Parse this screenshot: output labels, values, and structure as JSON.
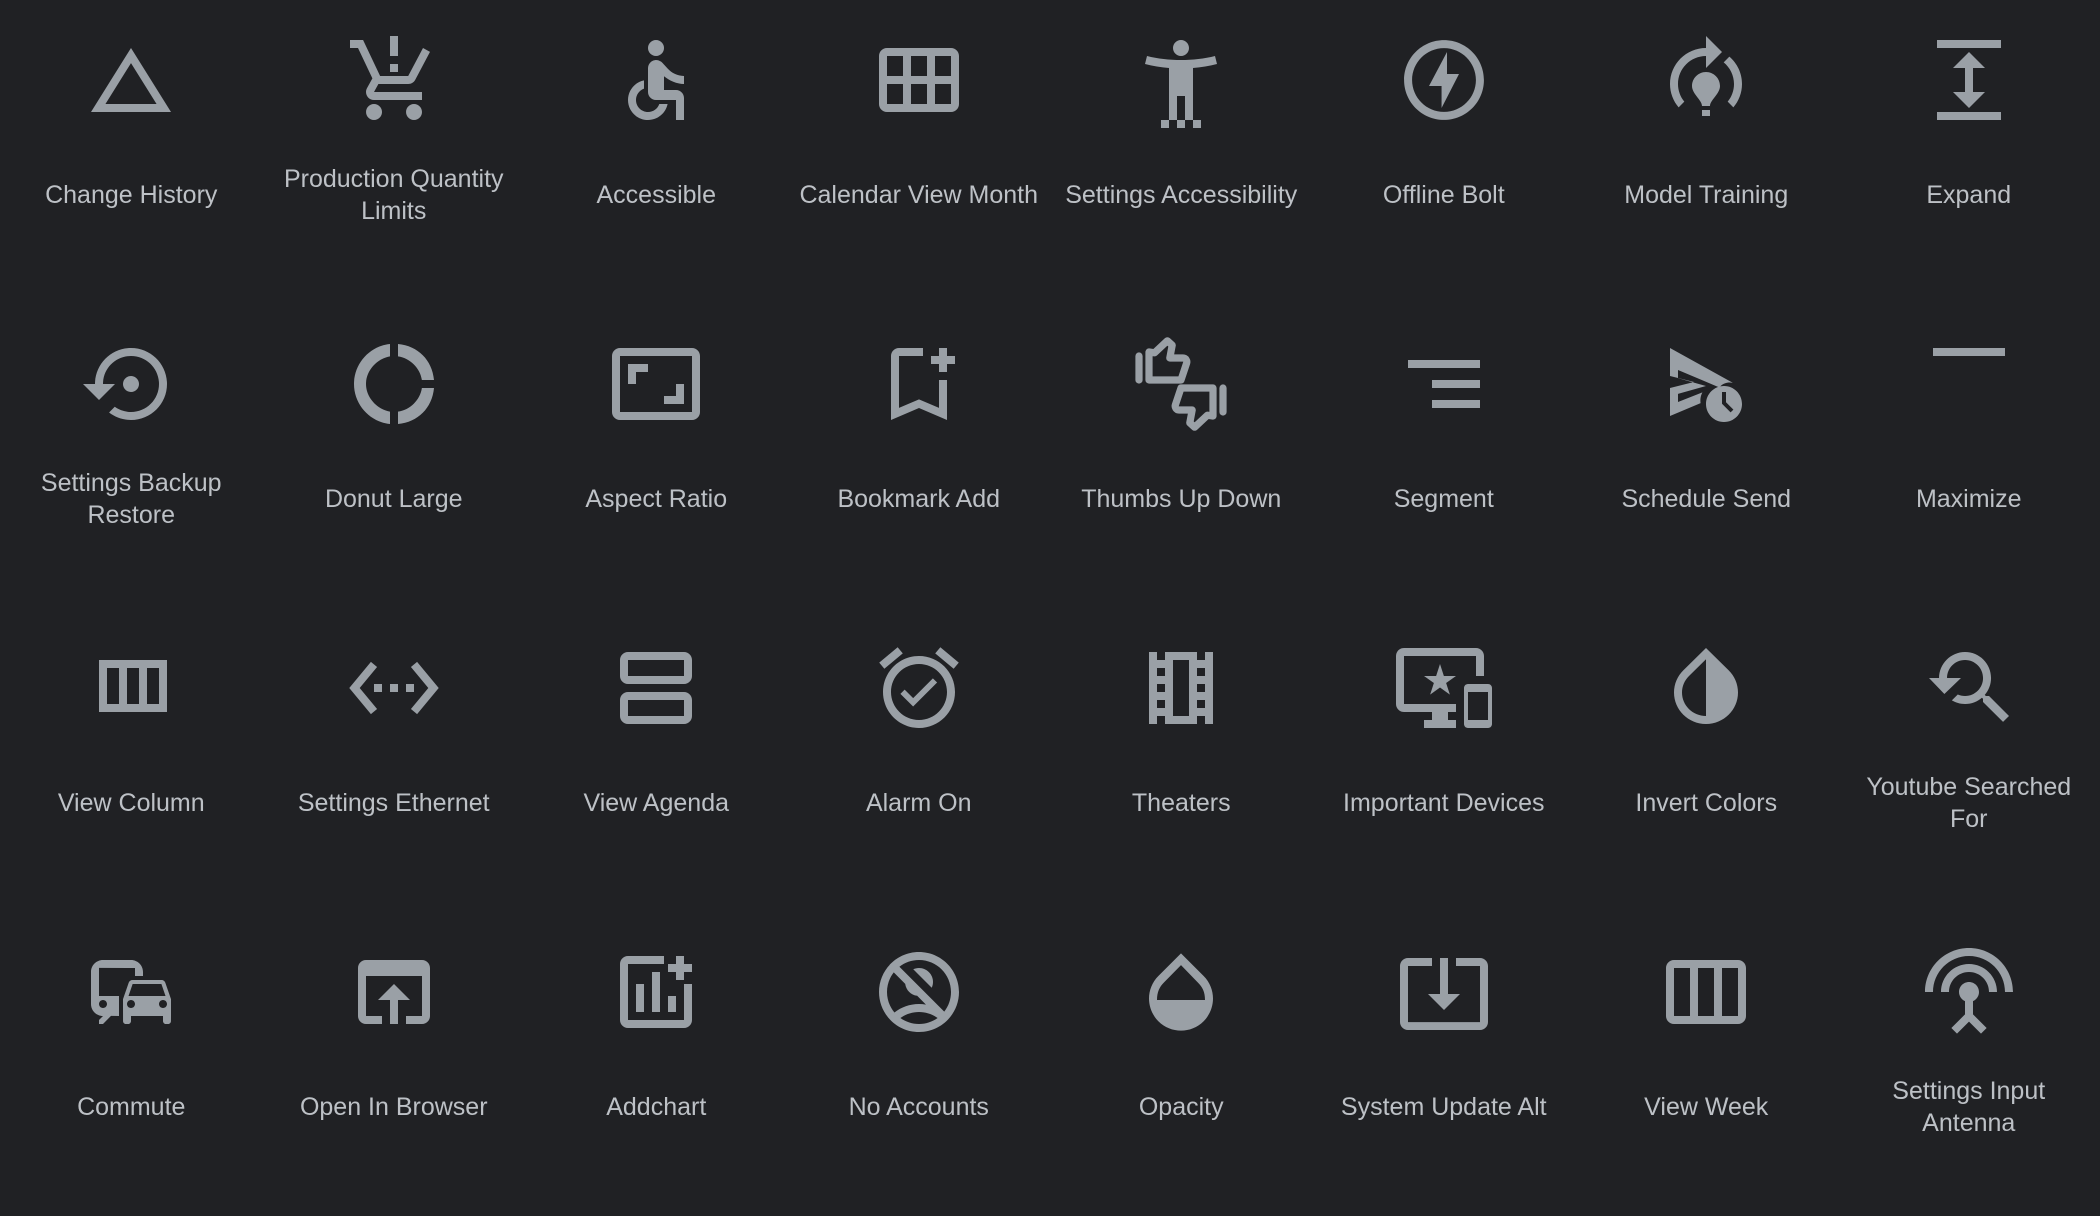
{
  "theme": {
    "background": "#202124",
    "icon_color": "#9aa0a6",
    "label_color": "#bdc1c6"
  },
  "icons": [
    {
      "label": "Change History",
      "icon": "change-history-icon"
    },
    {
      "label": "Production Quantity Limits",
      "icon": "production-quantity-limits-icon"
    },
    {
      "label": "Accessible",
      "icon": "accessible-icon"
    },
    {
      "label": "Calendar View Month",
      "icon": "calendar-view-month-icon"
    },
    {
      "label": "Settings Accessibility",
      "icon": "settings-accessibility-icon"
    },
    {
      "label": "Offline Bolt",
      "icon": "offline-bolt-icon"
    },
    {
      "label": "Model Training",
      "icon": "model-training-icon"
    },
    {
      "label": "Expand",
      "icon": "expand-icon"
    },
    {
      "label": "Settings Backup Restore",
      "icon": "settings-backup-restore-icon"
    },
    {
      "label": "Donut Large",
      "icon": "donut-large-icon"
    },
    {
      "label": "Aspect Ratio",
      "icon": "aspect-ratio-icon"
    },
    {
      "label": "Bookmark Add",
      "icon": "bookmark-add-icon"
    },
    {
      "label": "Thumbs Up Down",
      "icon": "thumbs-up-down-icon"
    },
    {
      "label": "Segment",
      "icon": "segment-icon"
    },
    {
      "label": "Schedule Send",
      "icon": "schedule-send-icon"
    },
    {
      "label": "Maximize",
      "icon": "maximize-icon"
    },
    {
      "label": "View Column",
      "icon": "view-column-icon"
    },
    {
      "label": "Settings Ethernet",
      "icon": "settings-ethernet-icon"
    },
    {
      "label": "View Agenda",
      "icon": "view-agenda-icon"
    },
    {
      "label": "Alarm On",
      "icon": "alarm-on-icon"
    },
    {
      "label": "Theaters",
      "icon": "theaters-icon"
    },
    {
      "label": "Important Devices",
      "icon": "important-devices-icon"
    },
    {
      "label": "Invert Colors",
      "icon": "invert-colors-icon"
    },
    {
      "label": "Youtube Searched For",
      "icon": "youtube-searched-for-icon"
    },
    {
      "label": "Commute",
      "icon": "commute-icon"
    },
    {
      "label": "Open In Browser",
      "icon": "open-in-browser-icon"
    },
    {
      "label": "Addchart",
      "icon": "addchart-icon"
    },
    {
      "label": "No Accounts",
      "icon": "no-accounts-icon"
    },
    {
      "label": "Opacity",
      "icon": "opacity-icon"
    },
    {
      "label": "System Update Alt",
      "icon": "system-update-alt-icon"
    },
    {
      "label": "View Week",
      "icon": "view-week-icon"
    },
    {
      "label": "Settings Input Antenna",
      "icon": "settings-input-antenna-icon"
    }
  ]
}
